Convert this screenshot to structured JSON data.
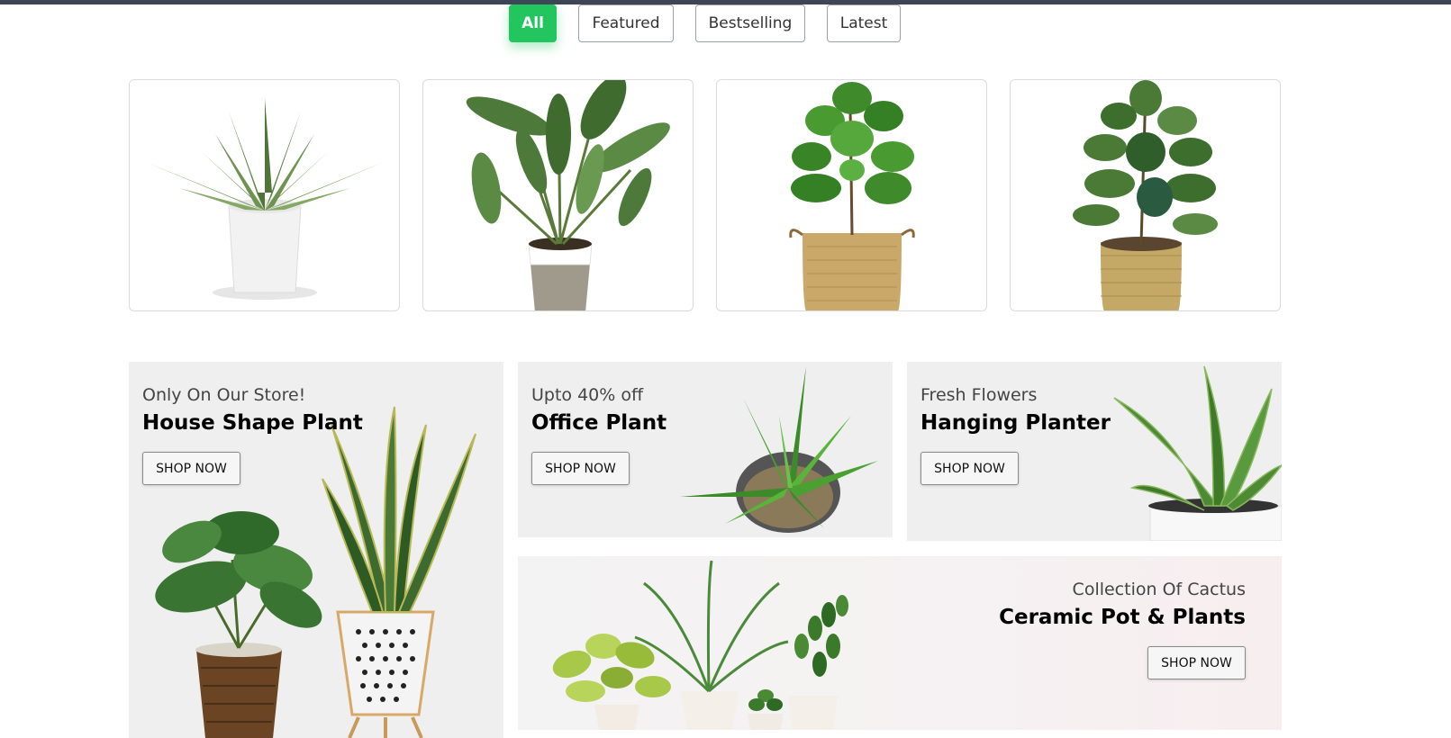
{
  "filters": {
    "tabs": [
      {
        "label": "All",
        "active": true
      },
      {
        "label": "Featured",
        "active": false
      },
      {
        "label": "Bestselling",
        "active": false
      },
      {
        "label": "Latest",
        "active": false
      }
    ]
  },
  "products": [
    {
      "image": "agave-plant-white-pot"
    },
    {
      "image": "bird-of-paradise-plant"
    },
    {
      "image": "fiddle-leaf-fig-basket"
    },
    {
      "image": "fiddle-leaf-fig-woven-basket"
    }
  ],
  "banners": {
    "house": {
      "subtitle": "Only On Our Store!",
      "title": "House Shape Plant",
      "button": "SHOP NOW"
    },
    "office": {
      "subtitle": "Upto 40% off",
      "title": "Office Plant",
      "button": "SHOP NOW"
    },
    "hanging": {
      "subtitle": "Fresh Flowers",
      "title": "Hanging Planter",
      "button": "SHOP NOW"
    },
    "cactus": {
      "subtitle": "Collection Of Cactus",
      "title": "Ceramic Pot & Plants",
      "button": "SHOP NOW"
    }
  },
  "colors": {
    "accent": "#22c55e",
    "top_bar": "#3d4557",
    "banner_bg": "#efefef"
  }
}
